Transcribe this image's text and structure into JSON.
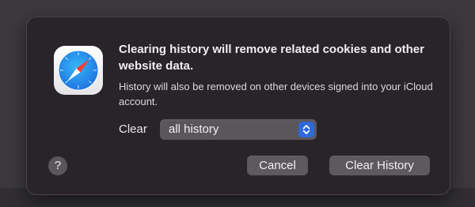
{
  "dialog": {
    "title": "Clearing history will remove related cookies and other website data.",
    "message": "History will also be removed on other devices signed into your iCloud account.",
    "clear_label": "Clear",
    "clear_select": {
      "value": "all history"
    },
    "help_label": "?",
    "cancel_label": "Cancel",
    "confirm_label": "Clear History"
  },
  "icons": {
    "app": "safari-compass-icon",
    "stepper": "up-down-chevron-icon"
  },
  "colors": {
    "sheet_background": "#29232a",
    "button_background": "#5d5a5f",
    "accent": "#2f69d9"
  }
}
